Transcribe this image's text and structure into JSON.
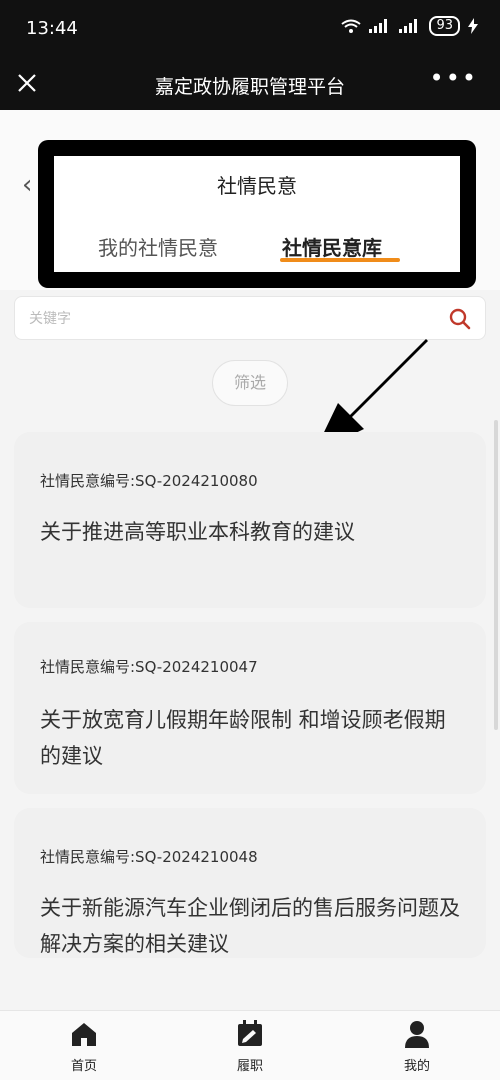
{
  "status_bar": {
    "time": "13:44",
    "battery": "93"
  },
  "nav": {
    "title": "嘉定政协履职管理平台",
    "more": "•••"
  },
  "header": {
    "title": "社情民意",
    "tabs": [
      {
        "label": "我的社情民意",
        "active": false
      },
      {
        "label": "社情民意库",
        "active": true
      }
    ]
  },
  "search": {
    "placeholder": "关键字",
    "value": ""
  },
  "filter": {
    "label": "筛选"
  },
  "records": [
    {
      "code": "社情民意编号:SQ-2024210080",
      "title": "关于推进高等职业本科教育的建议"
    },
    {
      "code": "社情民意编号:SQ-2024210047",
      "title": "关于放宽育儿假期年龄限制 和增设顾老假期的建议"
    },
    {
      "code": "社情民意编号:SQ-2024210048",
      "title": "关于新能源汽车企业倒闭后的售后服务问题及解决方案的相关建议"
    }
  ],
  "tabbar": [
    {
      "label": "首页",
      "icon": "home-icon"
    },
    {
      "label": "履职",
      "icon": "calendar-icon"
    },
    {
      "label": "我的",
      "icon": "user-icon"
    }
  ],
  "colors": {
    "accent": "#f08c1a",
    "search_icon": "#c0392b",
    "dark_bar": "#111111"
  }
}
